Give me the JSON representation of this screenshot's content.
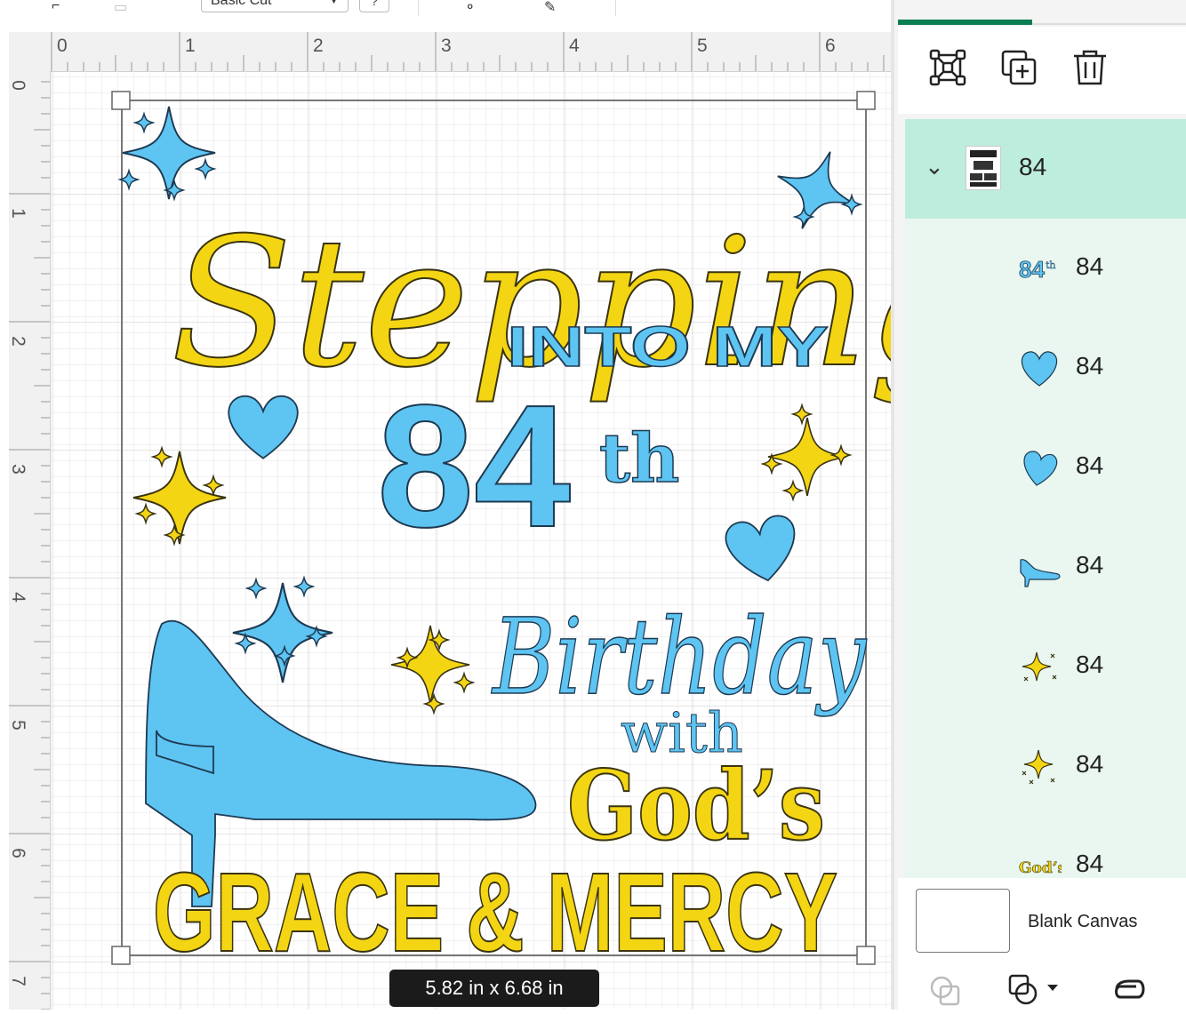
{
  "toolbar": {
    "operation_select": "Basic Cut",
    "help": "?"
  },
  "ruler": {
    "top_ticks": [
      "0",
      "1",
      "2",
      "3",
      "4",
      "5",
      "6"
    ],
    "left_ticks": [
      "0",
      "1",
      "2",
      "3",
      "4",
      "5",
      "6",
      "7"
    ]
  },
  "design": {
    "title_script": "Stepping",
    "into_my": "INTO MY",
    "age_number": "84",
    "age_suffix": "th",
    "birthday_script": "Birthday",
    "with": "with",
    "gods": "God’s",
    "grace_mercy": "GRACE & MERCY"
  },
  "size_readout": "5.82  in x 6.68  in",
  "layers": {
    "group": {
      "label": "84",
      "expanded": true
    },
    "items": [
      {
        "label": "84",
        "thumb": "84th-text-icon"
      },
      {
        "label": "84",
        "thumb": "heart-icon"
      },
      {
        "label": "84",
        "thumb": "heart-icon"
      },
      {
        "label": "84",
        "thumb": "shoe-icon"
      },
      {
        "label": "84",
        "thumb": "sparkle-cluster-icon"
      },
      {
        "label": "84",
        "thumb": "sparkle-cluster-icon"
      },
      {
        "label": "84",
        "thumb": "gods-text-icon"
      }
    ],
    "blank_canvas_label": "Blank Canvas"
  },
  "colors": {
    "yellow": "#f4d513",
    "blue": "#5ec4f2",
    "accent_green": "#0a7c52",
    "layer_selected_bg": "#bdeedd",
    "layer_bg": "#e9f7f0"
  }
}
